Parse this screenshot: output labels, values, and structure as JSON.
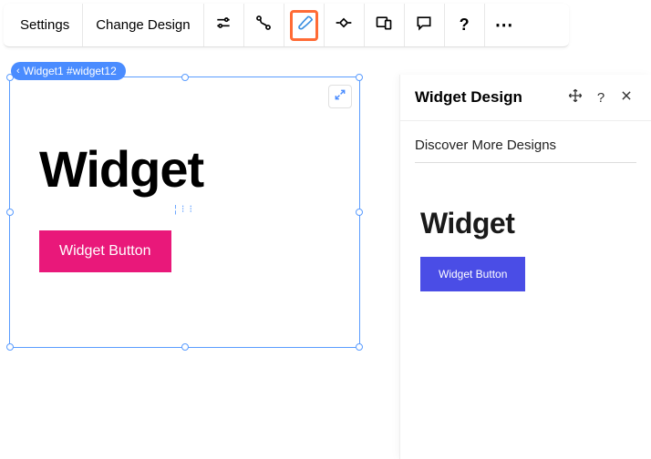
{
  "toolbar": {
    "settings_label": "Settings",
    "change_design_label": "Change Design",
    "icons": {
      "filters": "filters-icon",
      "animation": "connector-icon",
      "design": "brush-icon",
      "stretch": "diamond-icon",
      "responsive": "devices-icon",
      "comment": "comment-icon",
      "help": "?",
      "more": "⋯"
    }
  },
  "breadcrumb": {
    "label": "Widget1 #widget12"
  },
  "canvas": {
    "heading": "Widget",
    "button_label": "Widget Button",
    "button_bg": "#e9187a"
  },
  "panel": {
    "title": "Widget Design",
    "subtitle": "Discover More Designs",
    "help_label": "?",
    "preview": {
      "heading": "Widget",
      "button_label": "Widget Button",
      "button_bg": "#4a4de6"
    }
  }
}
